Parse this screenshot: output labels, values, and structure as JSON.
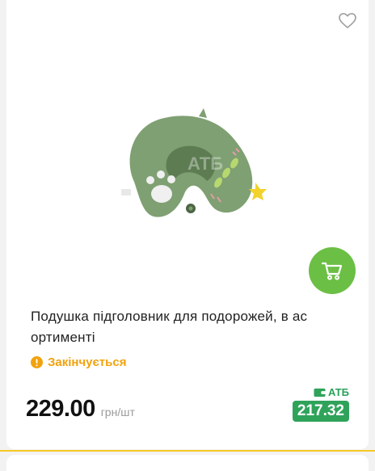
{
  "product": {
    "title": "Подушка підголовник для подорожей, в ас ортименті",
    "image_watermark": "АТБ",
    "status": "Закінчується",
    "price": "229.00",
    "unit": "грн/шт",
    "promo_label": "АТБ",
    "promo_price": "217.32"
  },
  "icons": {
    "favorite": "heart-outline-icon",
    "cart": "cart-icon",
    "status": "warning-icon",
    "promo": "wallet-icon"
  },
  "colors": {
    "cart_button": "#6cbf45",
    "status": "#f2a20c",
    "promo": "#2fa35a",
    "divider": "#f6c924"
  }
}
